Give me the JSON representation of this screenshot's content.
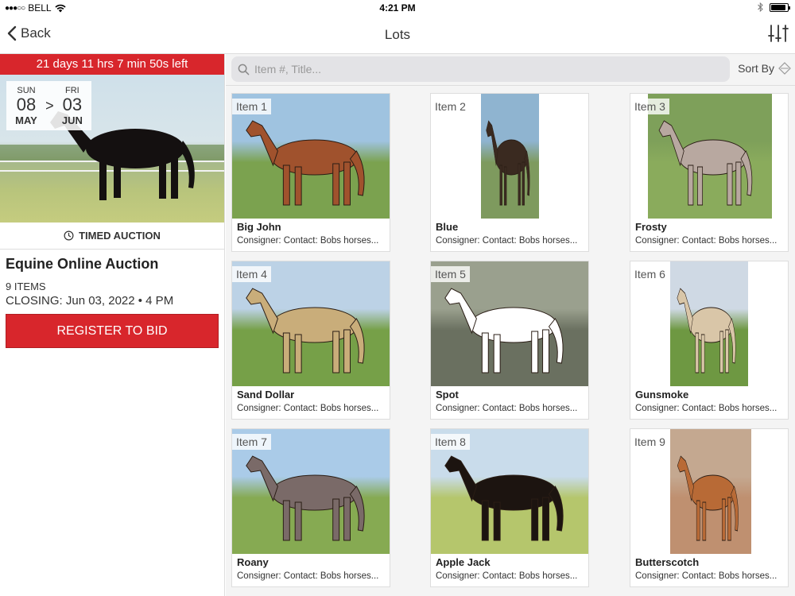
{
  "statusbar": {
    "carrier": "BELL",
    "time": "4:21 PM"
  },
  "navbar": {
    "back_label": "Back",
    "title": "Lots"
  },
  "auction": {
    "countdown": "21 days 11 hrs 7 min 50s left",
    "start": {
      "dow": "SUN",
      "day": "08",
      "month": "MAY"
    },
    "arrow": ">",
    "end": {
      "dow": "FRI",
      "day": "03",
      "month": "JUN"
    },
    "type": "TIMED AUCTION",
    "title": "Equine Online Auction",
    "items_count": "9 ITEMS",
    "closing": "CLOSING: Jun 03, 2022 • 4 PM",
    "register_label": "REGISTER TO BID"
  },
  "search": {
    "placeholder": "Item #, Title..."
  },
  "sort": {
    "label": "Sort By"
  },
  "lots": [
    {
      "item": "Item 1",
      "title": "Big John",
      "consignor": "Consigner: Contact: Bobs horses...",
      "coat": "#a0522d",
      "sky": "#9fc3e0",
      "grass": "#7ba24f"
    },
    {
      "item": "Item 2",
      "title": "Blue",
      "consignor": "Consigner: Contact: Bobs horses...",
      "coat": "#3a2a20",
      "sky": "#8fb4d0",
      "grass": "#7e9a5e"
    },
    {
      "item": "Item 3",
      "title": "Frosty",
      "consignor": "Consigner: Contact: Bobs horses...",
      "coat": "#b8a8a0",
      "sky": "#7ea05a",
      "grass": "#8aab5c"
    },
    {
      "item": "Item 4",
      "title": "Sand Dollar",
      "consignor": "Consigner: Contact: Bobs horses...",
      "coat": "#c9ad7a",
      "sky": "#bcd2e6",
      "grass": "#76a048"
    },
    {
      "item": "Item 5",
      "title": "Spot",
      "consignor": "Consigner: Contact: Bobs horses...",
      "coat": "#ffffff",
      "sky": "#9aa08e",
      "grass": "#6a7060"
    },
    {
      "item": "Item 6",
      "title": "Gunsmoke",
      "consignor": "Consigner: Contact: Bobs horses...",
      "coat": "#d9c6a8",
      "sky": "#cfd9e4",
      "grass": "#6e9842"
    },
    {
      "item": "Item 7",
      "title": "Roany",
      "consignor": "Consigner: Contact: Bobs horses...",
      "coat": "#7a6a68",
      "sky": "#aacbe8",
      "grass": "#86aa52"
    },
    {
      "item": "Item 8",
      "title": "Apple Jack",
      "consignor": "Consigner: Contact: Bobs horses...",
      "coat": "#1c1410",
      "sky": "#c9dceb",
      "grass": "#b5c66c"
    },
    {
      "item": "Item 9",
      "title": "Butterscotch",
      "consignor": "Consigner: Contact: Bobs horses...",
      "coat": "#b86a36",
      "sky": "#c4a890",
      "grass": "#bf9070"
    }
  ]
}
